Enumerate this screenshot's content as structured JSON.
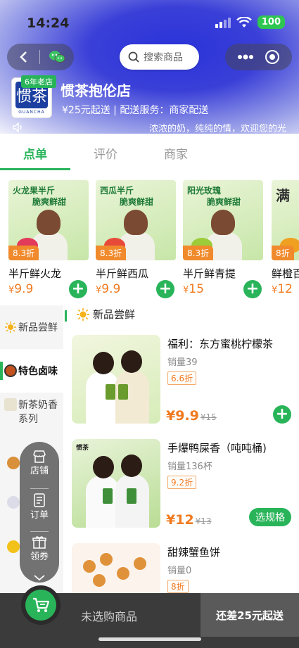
{
  "status_bar": {
    "time": "14:24",
    "battery": "100"
  },
  "nav": {
    "search_placeholder": "搜索商品"
  },
  "store": {
    "badge": "6年老店",
    "logo_text": "惯茶",
    "logo_sub": "GUANCHA",
    "name": "惯茶抱伦店",
    "info": "¥25元起送 | 配送服务：商家配送",
    "announcement": "浓浓的奶，纯纯的情，欢迎您的光"
  },
  "tabs": [
    {
      "label": "点单",
      "active": true
    },
    {
      "label": "评价",
      "active": false
    },
    {
      "label": "商家",
      "active": false
    }
  ],
  "featured": [
    {
      "title1": "火龙果半斤",
      "title2": "脆爽鲜甜",
      "discount": "8.3折",
      "name": "半斤鲜火龙",
      "price": "9.9",
      "fruit_color": "#e23a5a"
    },
    {
      "title1": "西瓜半斤",
      "title2": "脆爽鲜甜",
      "discount": "8.3折",
      "name": "半斤鲜西瓜",
      "price": "9.9",
      "fruit_color": "#e84a3a"
    },
    {
      "title1": "阳光玫瑰",
      "title2": "脆爽鲜甜",
      "discount": "8.3折",
      "name": "半斤鲜青提",
      "price": "15",
      "fruit_color": "#9ccc3a"
    },
    {
      "title1": "满",
      "title2": "",
      "discount": "8折",
      "name": "鲜橙百",
      "price": "12",
      "fruit_color": "#f0a020"
    }
  ],
  "sidebar": [
    {
      "label": "新品尝鲜",
      "active": false
    },
    {
      "label": "特色卤味",
      "active": true
    },
    {
      "label": "新茶奶香系列",
      "active": false
    }
  ],
  "section_title": "新品尝鲜",
  "products": [
    {
      "name": "福利：东方蜜桃柠檬茶",
      "sales": "销量39",
      "discount": "6.6折",
      "price": "¥9.9",
      "old_price": "¥15",
      "action": "plus"
    },
    {
      "name": "手爆鸭屎香（吨吨桶)",
      "sales": "销量136杯",
      "discount": "9.2折",
      "price": "¥12",
      "old_price": "¥13",
      "action": "选规格"
    },
    {
      "name": "甜辣蟹鱼饼",
      "sales": "销量0",
      "discount": "8折",
      "price": "",
      "old_price": "",
      "action": ""
    }
  ],
  "float_menu": [
    {
      "label": "店铺"
    },
    {
      "label": "订单"
    },
    {
      "label": "领券"
    }
  ],
  "bottom_bar": {
    "cart_status": "未选购商品",
    "checkout_label": "还差25元起送"
  },
  "colors": {
    "brand_green": "#29b45a",
    "price_orange": "#f07a1f",
    "header_blue": "#2a33d9"
  }
}
